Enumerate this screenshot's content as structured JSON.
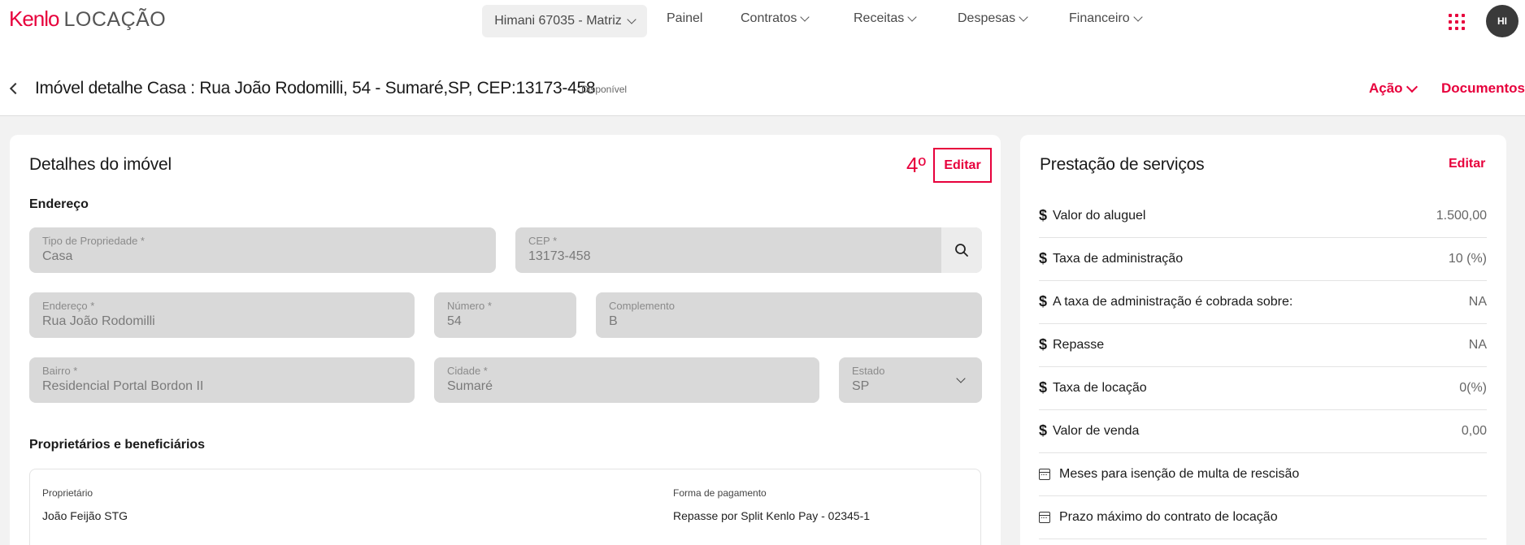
{
  "topbar": {
    "logo_brand": "Kenlo",
    "logo_product": "LOCAÇÃO",
    "org_switch": "Himani 67035 - Matriz",
    "nav": [
      "Painel",
      "Contratos",
      "Receitas",
      "Despesas",
      "Financeiro"
    ],
    "avatar_initials": "HI"
  },
  "page_header": {
    "title": "Imóvel detalhe  Casa : Rua João Rodomilli, 54 - Sumaré,SP, CEP:13173-458",
    "status": "Disponível",
    "action_label": "Ação",
    "documents_label": "Documentos"
  },
  "details": {
    "title": "Detalhes do imóvel",
    "step_marker": "4º",
    "edit_label": "Editar",
    "address_section": "Endereço",
    "fields": {
      "tipo": {
        "label": "Tipo de Propriedade *",
        "value": "Casa"
      },
      "cep": {
        "label": "CEP *",
        "value": "13173-458"
      },
      "endereco": {
        "label": "Endereço *",
        "value": "Rua João Rodomilli"
      },
      "numero": {
        "label": "Número *",
        "value": "54"
      },
      "complemento": {
        "label": "Complemento",
        "value": "B"
      },
      "bairro": {
        "label": "Bairro *",
        "value": "Residencial Portal Bordon II"
      },
      "cidade": {
        "label": "Cidade *",
        "value": "Sumaré"
      },
      "estado": {
        "label": "Estado",
        "value": "SP"
      }
    },
    "owners_section": "Proprietários e beneficiários",
    "owner_label": "Proprietário",
    "owner_value": "João Feijão STG",
    "payment_label": "Forma de pagamento",
    "payment_value": "Repasse por Split Kenlo Pay - 02345-1"
  },
  "services": {
    "title": "Prestação de serviços",
    "edit_label": "Editar",
    "rows": [
      {
        "icon": "dollar-icon",
        "label": "Valor do aluguel",
        "value": "1.500,00"
      },
      {
        "icon": "dollar-icon",
        "label": "Taxa de administração",
        "value": "10 (%)"
      },
      {
        "icon": "dollar-icon",
        "label": "A taxa de administração é cobrada sobre:",
        "value": "NA"
      },
      {
        "icon": "dollar-icon",
        "label": "Repasse",
        "value": "NA"
      },
      {
        "icon": "dollar-icon",
        "label": "Taxa de locação",
        "value": "0(%)"
      },
      {
        "icon": "dollar-icon",
        "label": "Valor de venda",
        "value": "0,00"
      },
      {
        "icon": "calendar-icon",
        "label": "Meses para isenção de multa de rescisão",
        "value": ""
      },
      {
        "icon": "calendar-icon",
        "label": "Prazo máximo do contrato de locação",
        "value": ""
      }
    ]
  },
  "colors": {
    "accent": "#e7003c",
    "field_bg": "#d9d9d9",
    "page_bg": "#f2f2f2"
  }
}
